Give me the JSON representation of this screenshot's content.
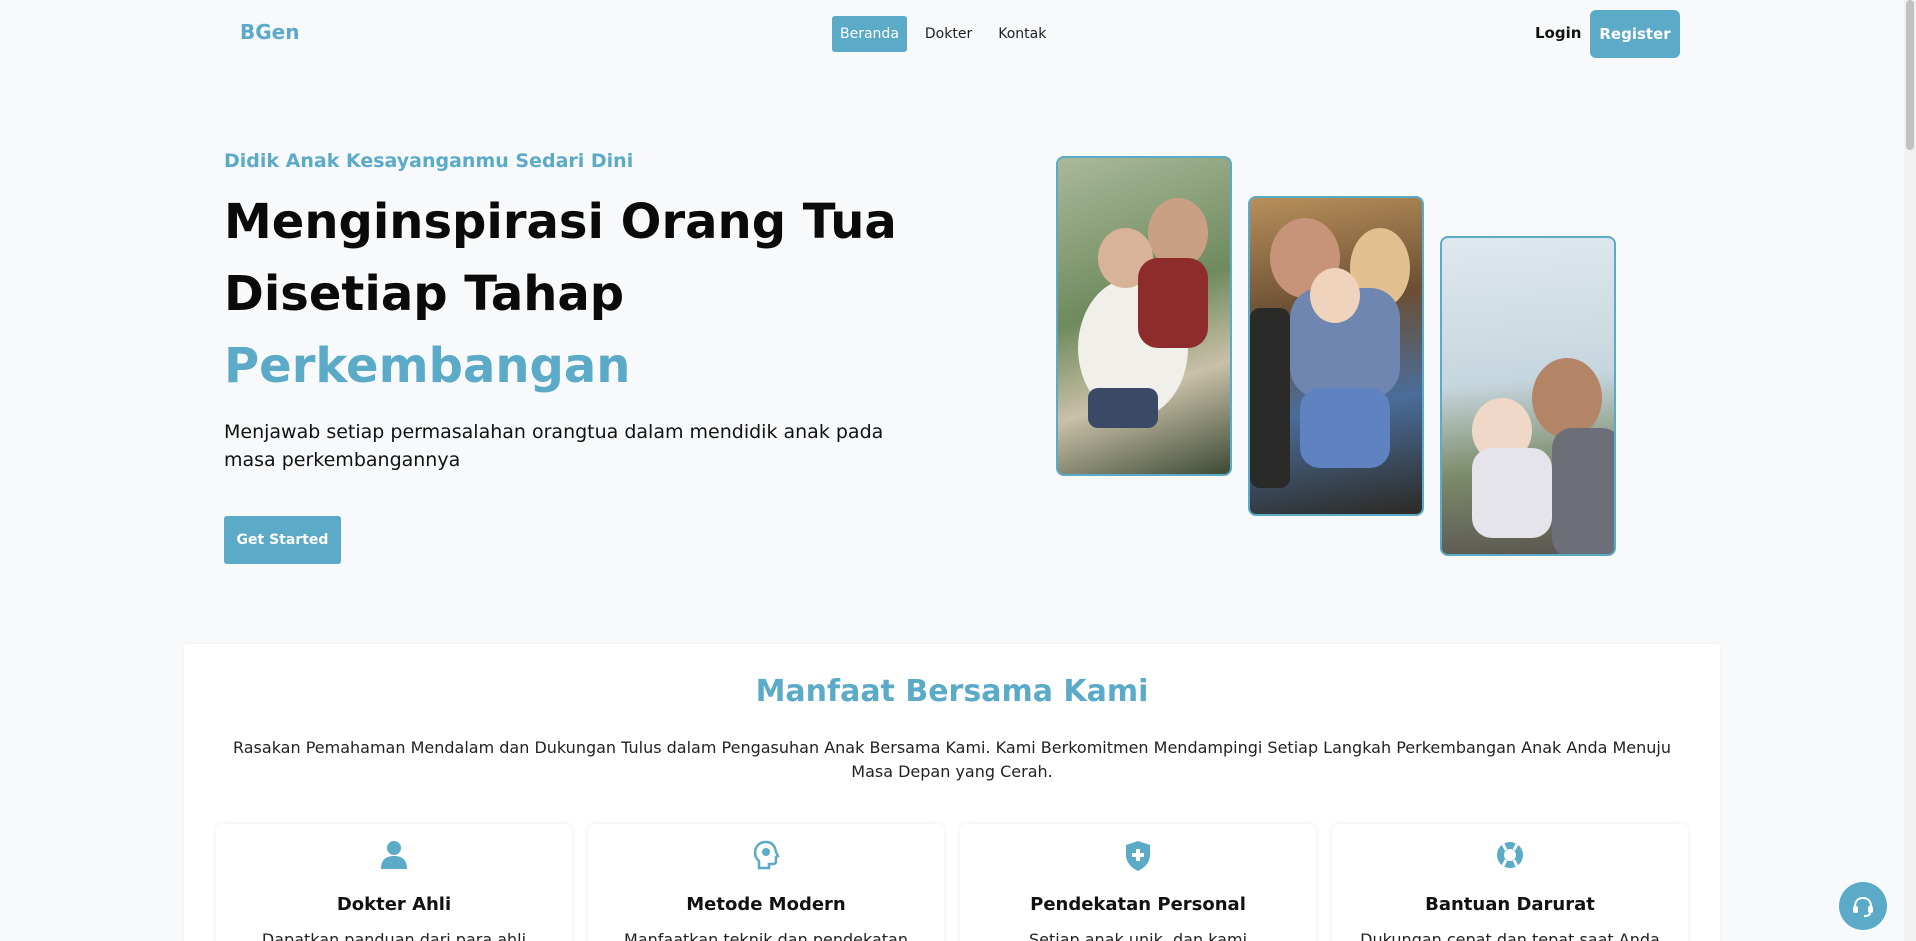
{
  "nav": {
    "brand": "BGen",
    "links": [
      {
        "label": "Beranda",
        "active": true
      },
      {
        "label": "Dokter",
        "active": false
      },
      {
        "label": "Kontak",
        "active": false
      }
    ],
    "login_label": "Login",
    "register_label": "Register"
  },
  "hero": {
    "subtitle": "Didik Anak Kesayanganmu Sedari Dini",
    "title_line1": "Menginspirasi Orang Tua",
    "title_line2": "Disetiap Tahap",
    "title_accent": "Perkembangan",
    "description": "Menjawab setiap permasalahan orangtua dalam mendidik anak pada masa perkembangannya",
    "cta_label": "Get Started"
  },
  "features": {
    "title": "Manfaat Bersama Kami",
    "description": "Rasakan Pemahaman Mendalam dan Dukungan Tulus dalam Pengasuhan Anak Bersama Kami. Kami Berkomitmen Mendampingi Setiap Langkah Perkembangan Anak Anda Menuju Masa Depan yang Cerah.",
    "cards": [
      {
        "icon": "person-icon",
        "title": "Dokter Ahli",
        "text": "Dapatkan panduan dari para ahli"
      },
      {
        "icon": "brain-icon",
        "title": "Metode Modern",
        "text": "Manfaatkan teknik dan pendekatan"
      },
      {
        "icon": "shield-plus-icon",
        "title": "Pendekatan Personal",
        "text": "Setiap anak unik, dan kami"
      },
      {
        "icon": "lifebuoy-icon",
        "title": "Bantuan Darurat",
        "text": "Dukungan cepat dan tepat saat Anda"
      }
    ]
  },
  "colors": {
    "accent": "#5aaac8",
    "background": "#f8f9fa"
  }
}
